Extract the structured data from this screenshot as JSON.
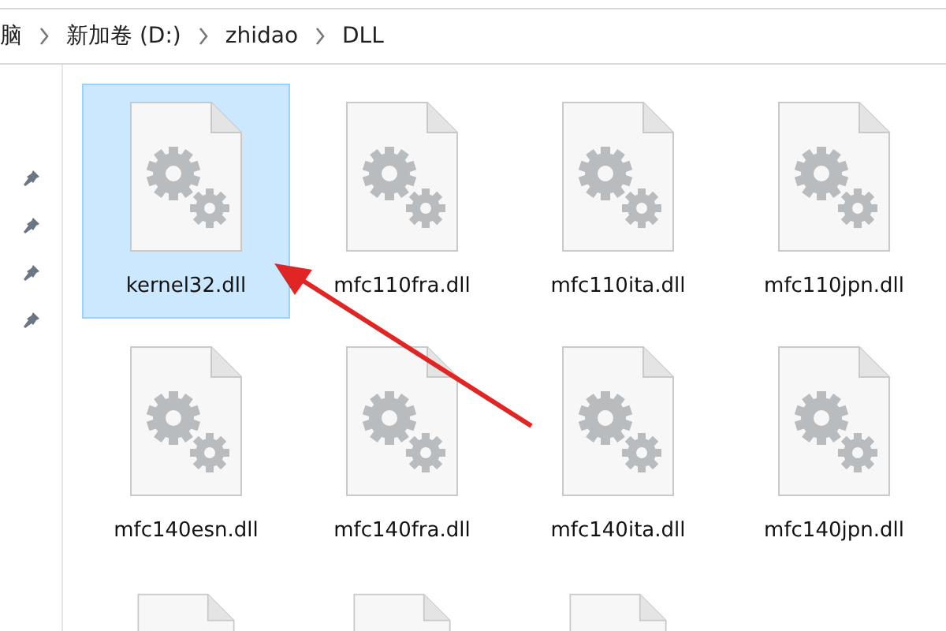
{
  "breadcrumb": [
    {
      "label": "脑"
    },
    {
      "label": "新加卷 (D:)"
    },
    {
      "label": "zhidao"
    },
    {
      "label": "DLL"
    }
  ],
  "quick_access": [
    {
      "pinned": true
    },
    {
      "pinned": true
    },
    {
      "pinned": true
    },
    {
      "pinned": true
    }
  ],
  "files": [
    {
      "name": "kernel32.dll",
      "selected": true
    },
    {
      "name": "mfc110fra.dll",
      "selected": false
    },
    {
      "name": "mfc110ita.dll",
      "selected": false
    },
    {
      "name": "mfc110jpn.dll",
      "selected": false
    },
    {
      "name": "mfc140esn.dll",
      "selected": false
    },
    {
      "name": "mfc140fra.dll",
      "selected": false
    },
    {
      "name": "mfc140ita.dll",
      "selected": false
    },
    {
      "name": "mfc140jpn.dll",
      "selected": false
    }
  ],
  "partial_files": [
    {
      "kind": "file"
    },
    {
      "kind": "file"
    },
    {
      "kind": "file"
    }
  ]
}
